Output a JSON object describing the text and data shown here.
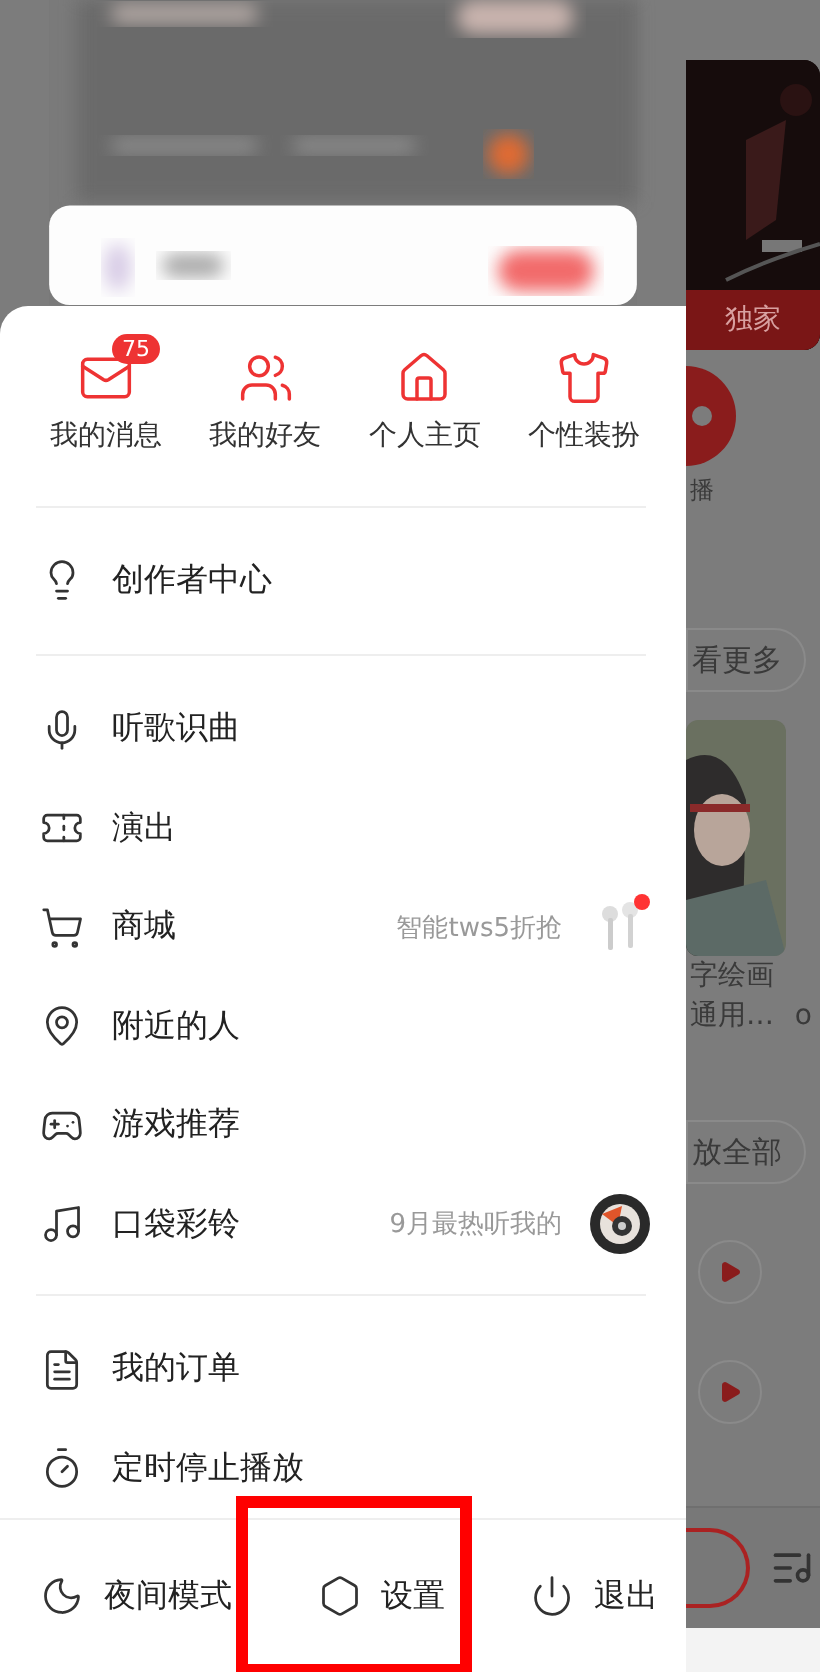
{
  "quick_actions": [
    {
      "label": "我的消息",
      "badge": "75"
    },
    {
      "label": "我的好友"
    },
    {
      "label": "个人主页"
    },
    {
      "label": "个性装扮"
    }
  ],
  "menu_sections": [
    [
      {
        "label": "创作者中心"
      }
    ],
    [
      {
        "label": "听歌识曲"
      },
      {
        "label": "演出"
      },
      {
        "label": "商城",
        "hint": "智能tws5折抢",
        "notification": true
      },
      {
        "label": "附近的人"
      },
      {
        "label": "游戏推荐"
      },
      {
        "label": "口袋彩铃",
        "hint": "9月最热听我的"
      }
    ],
    [
      {
        "label": "我的订单"
      },
      {
        "label": "定时停止播放"
      }
    ]
  ],
  "bottom_bar": [
    {
      "label": "夜间模式",
      "highlighted": false
    },
    {
      "label": "设置",
      "highlighted": true
    },
    {
      "label": "退出",
      "highlighted": false
    }
  ],
  "background_page": {
    "tag": "独家",
    "channel_label": "播",
    "more_button": "看更多",
    "card_title": [
      "字绘画",
      "通用…"
    ],
    "side_text": "o",
    "play_all_button": "放全部"
  }
}
